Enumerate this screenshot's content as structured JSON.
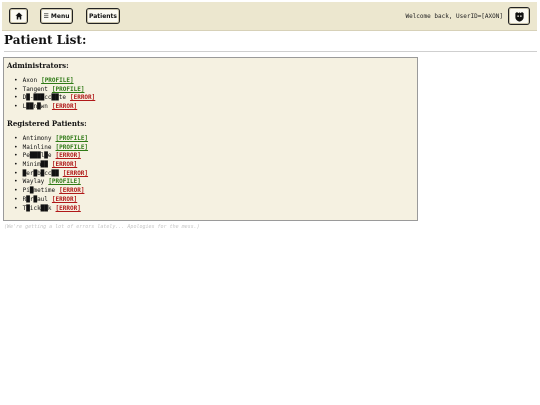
{
  "header": {
    "home_icon": "home-icon",
    "menu_label": "☰ Menu",
    "patients_label": "Patients",
    "welcome_text": "Welcome back, UserID=[AXON]",
    "shield_icon": "shield-icon"
  },
  "page": {
    "title": "Patient List:"
  },
  "administrators": {
    "heading": "Administrators:",
    "items": [
      {
        "name": "Axon",
        "tag": "[PROFILE]",
        "status": "profile"
      },
      {
        "name": "Tangent",
        "tag": "[PROFILE]",
        "status": "profile"
      },
      {
        "name": "D█-███cc██te",
        "tag": "[ERROR]",
        "status": "error"
      },
      {
        "name": "L██n█wn",
        "tag": "[ERROR]",
        "status": "error"
      }
    ]
  },
  "registered": {
    "heading": "Registered Patients:",
    "items": [
      {
        "name": "Antimony",
        "tag": "[PROFILE]",
        "status": "profile"
      },
      {
        "name": "Mainline",
        "tag": "[PROFILE]",
        "status": "profile"
      },
      {
        "name": "Pe███l█e",
        "tag": "[ERROR]",
        "status": "error"
      },
      {
        "name": "Minim██",
        "tag": "[ERROR]",
        "status": "error"
      },
      {
        "name": "█er█b█cc██",
        "tag": "[ERROR]",
        "status": "error"
      },
      {
        "name": "Waylay",
        "tag": "[PROFILE]",
        "status": "profile"
      },
      {
        "name": "Pi█metime",
        "tag": "[ERROR]",
        "status": "error"
      },
      {
        "name": "R█r█aul",
        "tag": "[ERROR]",
        "status": "error"
      },
      {
        "name": "T█ick██k",
        "tag": "[ERROR]",
        "status": "error"
      }
    ]
  },
  "footer": {
    "note": "(We're getting a lot of errors lately... Apologies for the mess.)"
  },
  "colors": {
    "header_bg": "#ece7cf",
    "panel_bg": "#f5f1e1",
    "profile": "#2f7a16",
    "error": "#b01818"
  }
}
